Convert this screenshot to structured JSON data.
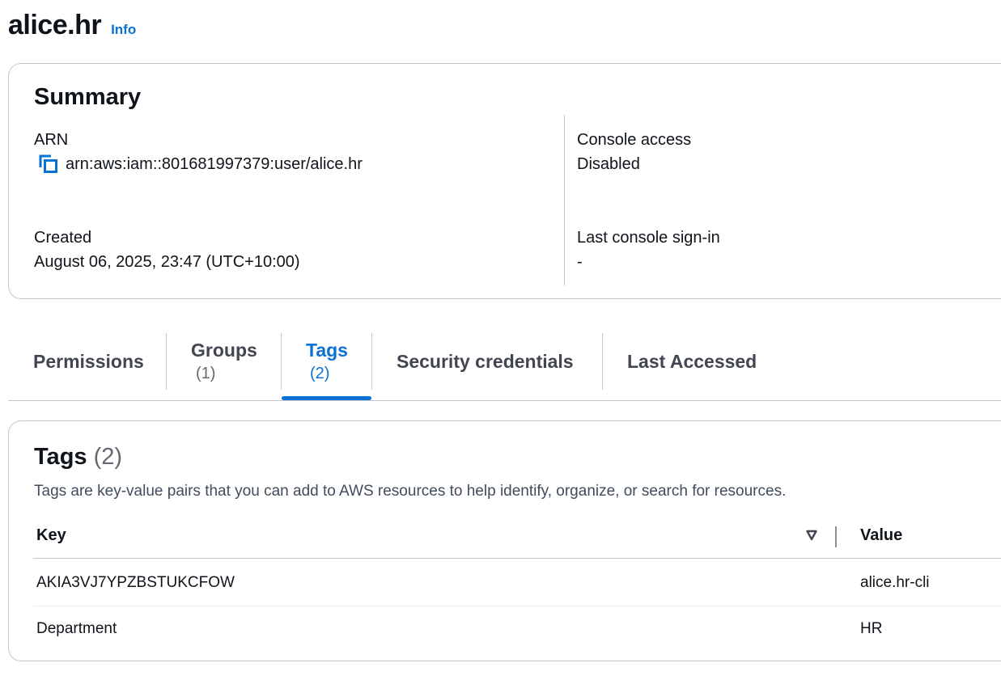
{
  "header": {
    "title": "alice.hr",
    "info_link": "Info"
  },
  "summary": {
    "title": "Summary",
    "arn": {
      "label": "ARN",
      "value": "arn:aws:iam::801681997379:user/alice.hr",
      "copy_icon": "copy-icon"
    },
    "created": {
      "label": "Created",
      "value": "August 06, 2025, 23:47 (UTC+10:00)"
    },
    "console_access": {
      "label": "Console access",
      "value": "Disabled"
    },
    "last_sign_in": {
      "label": "Last console sign-in",
      "value": "-"
    }
  },
  "tabs": [
    {
      "label": "Permissions",
      "count": ""
    },
    {
      "label": "Groups",
      "count": "(1)"
    },
    {
      "label": "Tags",
      "count": "(2)",
      "active": true
    },
    {
      "label": "Security credentials",
      "count": ""
    },
    {
      "label": "Last Accessed",
      "count": ""
    }
  ],
  "tags_panel": {
    "title": "Tags",
    "count": "(2)",
    "description": "Tags are key-value pairs that you can add to AWS resources to help identify, organize, or search for resources.",
    "columns": {
      "key": "Key",
      "value": "Value"
    },
    "rows": [
      {
        "key": "AKIA3VJ7YPZBSTUKCFOW",
        "value": "alice.hr-cli"
      },
      {
        "key": "Department",
        "value": "HR"
      }
    ]
  },
  "colors": {
    "accent": "#0972d3",
    "text": "#0f141a",
    "border": "#c6c6cd",
    "muted": "#656871"
  }
}
